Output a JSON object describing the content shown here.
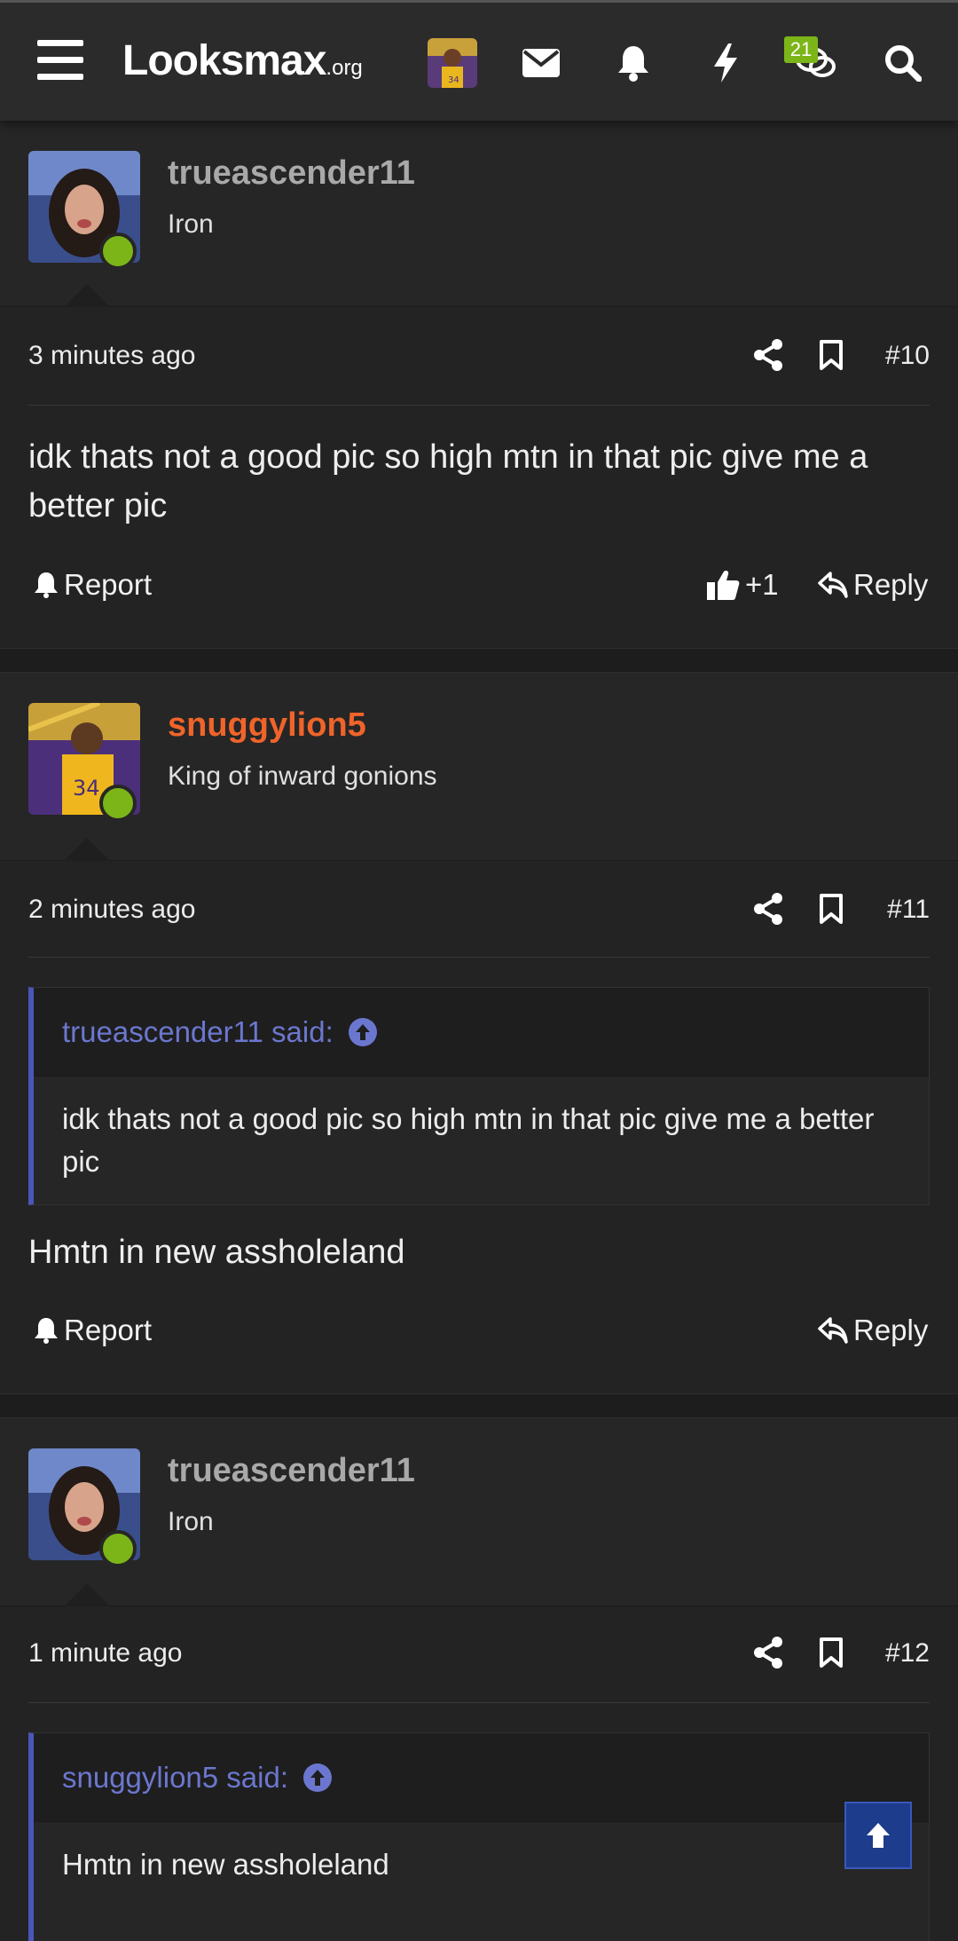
{
  "header": {
    "logo_main": "Looksmax",
    "logo_domain": ".org",
    "chat_badge": "21",
    "icons": [
      "menu-icon",
      "envelope-icon",
      "bell-icon",
      "lightning-icon",
      "chat-icon",
      "search-icon"
    ]
  },
  "posts": [
    {
      "username": "trueascender11",
      "user_title": "Iron",
      "time": "3 minutes ago",
      "number": "#10",
      "body": "idk thats not a good pic so high mtn in that pic give me a better pic",
      "report_label": "Report",
      "like_count": "+1",
      "reply_label": "Reply"
    },
    {
      "username": "snuggylion5",
      "user_title": "King of inward gonions",
      "time": "2 minutes ago",
      "number": "#11",
      "quote_author": "trueascender11 said:",
      "quote_text": "idk thats not a good pic so high mtn in that pic give me a better pic",
      "body": "Hmtn in new assholeland",
      "report_label": "Report",
      "reply_label": "Reply"
    },
    {
      "username": "trueascender11",
      "user_title": "Iron",
      "time": "1 minute ago",
      "number": "#12",
      "quote_author": "snuggylion5 said:",
      "quote_text": "Hmtn in new assholeland"
    }
  ],
  "colors": {
    "accent_green": "#7cb518",
    "username_orange": "#f0642a",
    "quote_blue": "#6b77cf",
    "scroll_top_blue": "#1e3c8c"
  }
}
